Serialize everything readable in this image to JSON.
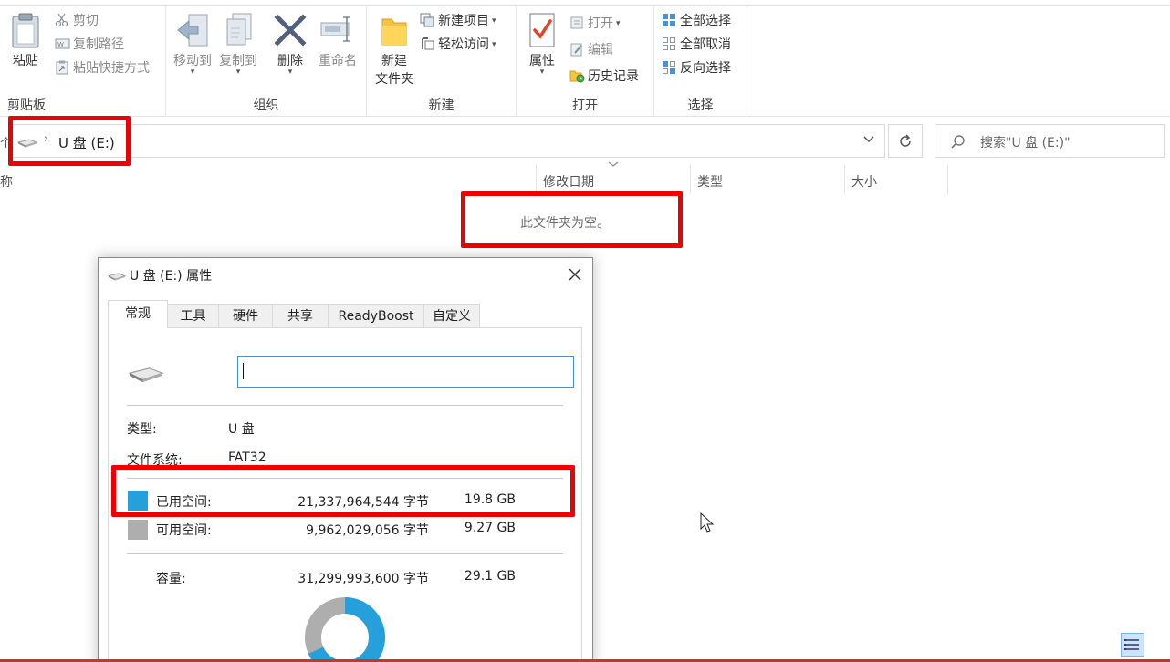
{
  "ribbon": {
    "clipboard": {
      "paste": "粘贴",
      "cut": "剪切",
      "copy_path": "复制路径",
      "paste_shortcut": "粘贴快捷方式",
      "group": "剪贴板"
    },
    "organize": {
      "move_to": "移动到",
      "copy_to": "复制到",
      "delete": "删除",
      "rename": "重命名",
      "group": "组织"
    },
    "new": {
      "new_folder_line1": "新建",
      "new_folder_line2": "文件夹",
      "new_item": "新建项目",
      "easy_access": "轻松访问",
      "group": "新建"
    },
    "open": {
      "properties": "属性",
      "open": "打开",
      "edit": "编辑",
      "history": "历史记录",
      "group": "打开"
    },
    "select": {
      "select_all": "全部选择",
      "select_none": "全部取消",
      "invert": "反向选择",
      "group": "选择"
    }
  },
  "address": {
    "back": "个",
    "path": "U 盘 (E:)",
    "search_placeholder": "搜索\"U 盘 (E:)\""
  },
  "filelist": {
    "col_name": "称",
    "col_modified": "修改日期",
    "col_type": "类型",
    "col_size": "大小",
    "empty": "此文件夹为空。"
  },
  "dialog": {
    "title": "U 盘 (E:) 属性",
    "tabs": [
      "常规",
      "工具",
      "硬件",
      "共享",
      "ReadyBoost",
      "自定义"
    ],
    "name_value": "",
    "type_label": "类型:",
    "type_value": "U 盘",
    "fs_label": "文件系统:",
    "fs_value": "FAT32",
    "used_label": "已用空间:",
    "used_bytes": "21,337,964,544 字节",
    "used_gb": "19.8 GB",
    "free_label": "可用空间:",
    "free_bytes": "9,962,029,056 字节",
    "free_gb": "9.27 GB",
    "capacity_label": "容量:",
    "capacity_bytes": "31,299,993,600 字节",
    "capacity_gb": "29.1 GB",
    "used_fraction": 0.682,
    "colors": {
      "used": "#26a0da",
      "free": "#aeaeae"
    }
  }
}
